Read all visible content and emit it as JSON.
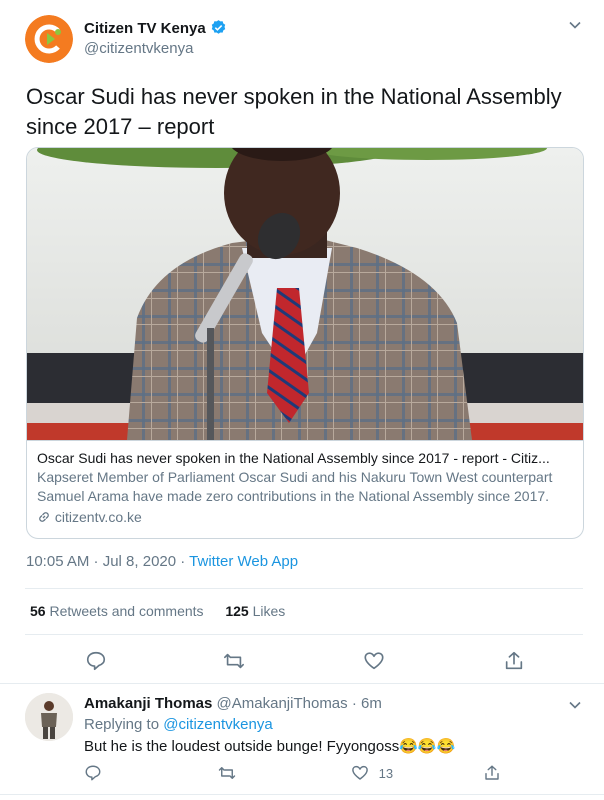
{
  "tweet": {
    "author_name": "Citizen TV Kenya",
    "author_handle": "@citizentvkenya",
    "text": "Oscar Sudi has never spoken in the National Assembly since 2017 – report",
    "card": {
      "title": "Oscar Sudi has never spoken in the National Assembly since 2017 - report - Citiz...",
      "description": "Kapseret Member of Parliament Oscar Sudi and his Nakuru Town West counterpart Samuel Arama have made zero contributions in the National Assembly since 2017.",
      "domain": "citizentv.co.ke"
    },
    "timestamp": "10:05 AM · Jul 8, 2020 · ",
    "source": "Twitter Web App",
    "retweets_count": "56",
    "retweets_label": " Retweets and comments",
    "likes_count": "125",
    "likes_label": " Likes"
  },
  "reply": {
    "author_name": "Amakanji Thomas",
    "author_handle": "@AmakanjiThomas",
    "time": " · 6m",
    "replying_prefix": "Replying to ",
    "replying_to": "@citizentvkenya",
    "text": "But he is the loudest outside bunge! Fyyongoss😂😂😂",
    "like_count": "13"
  },
  "colors": {
    "accent": "#1b95e0",
    "logo_orange": "#f47b20",
    "text": "#14171a",
    "muted": "#657786",
    "border": "#e6ecf0"
  },
  "icons": [
    "verified-badge-icon",
    "chevron-down-icon",
    "link-icon",
    "comment-icon",
    "retweet-icon",
    "like-icon",
    "share-icon"
  ]
}
